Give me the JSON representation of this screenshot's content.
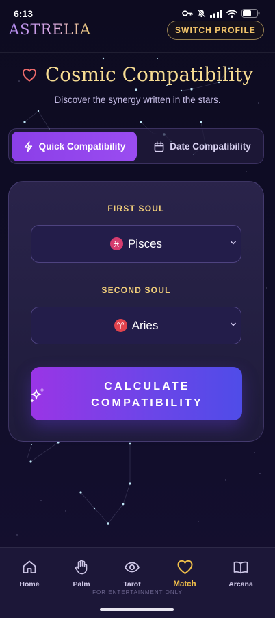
{
  "status_bar": {
    "time": "6:13"
  },
  "header": {
    "brand": "ASTRELIA",
    "switch_profile": "SWITCH PROFILE"
  },
  "page": {
    "title": "Cosmic Compatibility",
    "subtitle": "Discover the synergy written in the stars."
  },
  "tabs": [
    {
      "label": "Quick Compatibility",
      "icon": "lightning-icon",
      "active": true
    },
    {
      "label": "Date Compatibility",
      "icon": "calendar-icon",
      "active": false
    }
  ],
  "form": {
    "first_label": "FIRST SOUL",
    "first_value": "Pisces",
    "first_symbol": "♓",
    "second_label": "SECOND SOUL",
    "second_value": "Aries",
    "second_symbol": "♈",
    "calculate_line1": "CALCULATE",
    "calculate_line2": "COMPATIBILITY"
  },
  "nav": {
    "items": [
      {
        "label": "Home",
        "icon": "home-icon",
        "active": false
      },
      {
        "label": "Palm",
        "icon": "hand-icon",
        "active": false
      },
      {
        "label": "Tarot",
        "icon": "eye-icon",
        "active": false
      },
      {
        "label": "Match",
        "icon": "heart-icon",
        "active": true
      },
      {
        "label": "Arcana",
        "icon": "book-icon",
        "active": false
      }
    ],
    "footer": "FOR ENTERTAINMENT ONLY"
  },
  "colors": {
    "accent_gold": "#f2cf7a",
    "accent_purple": "#8b3fe8",
    "pisces_badge": "#d63c6e",
    "aries_badge": "#e0434d"
  }
}
